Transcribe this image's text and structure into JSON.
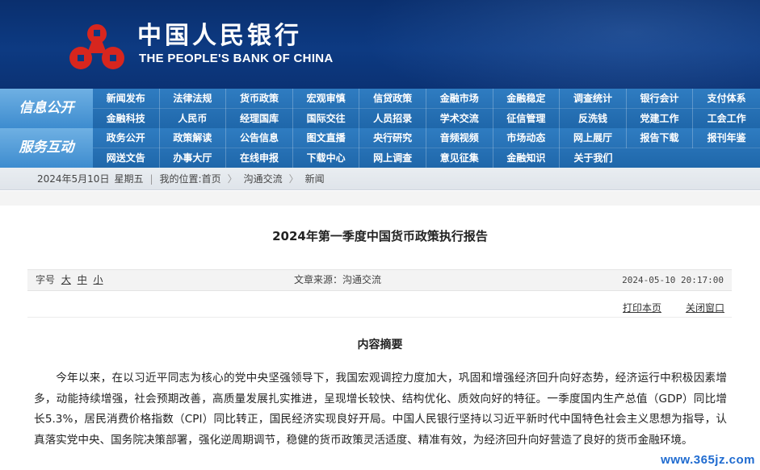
{
  "header": {
    "name_cn": "中国人民银行",
    "name_en": "THE PEOPLE'S BANK OF CHINA",
    "logo_color": "#d7261e"
  },
  "nav": {
    "info_label": "信息公开",
    "service_label": "服务互动",
    "info_row1": [
      "新闻发布",
      "法律法规",
      "货币政策",
      "宏观审慎",
      "信贷政策",
      "金融市场",
      "金融稳定",
      "调查统计",
      "银行会计",
      "支付体系"
    ],
    "info_row2": [
      "金融科技",
      "人民币",
      "经理国库",
      "国际交往",
      "人员招录",
      "学术交流",
      "征信管理",
      "反洗钱",
      "党建工作",
      "工会工作"
    ],
    "service_row1": [
      "政务公开",
      "政策解读",
      "公告信息",
      "图文直播",
      "央行研究",
      "音频视频",
      "市场动态",
      "网上展厅",
      "报告下载",
      "报刊年鉴"
    ],
    "service_row2": [
      "网送文告",
      "办事大厅",
      "在线申报",
      "下载中心",
      "网上调查",
      "意见征集",
      "金融知识",
      "关于我们"
    ]
  },
  "breadcrumb": {
    "date": "2024年5月10日",
    "weekday": "星期五",
    "location_label": "我的位置:",
    "home": "首页",
    "section": "沟通交流",
    "current": "新闻",
    "sep": "〉"
  },
  "article": {
    "title": "2024年第一季度中国货币政策执行报告",
    "font_size_label": "字号",
    "font_sizes": [
      "大",
      "中",
      "小"
    ],
    "source": "文章来源：沟通交流",
    "datetime": "2024-05-10 20:17:00",
    "print_label": "打印本页",
    "close_label": "关闭窗口",
    "section_title": "内容摘要",
    "paragraph": "今年以来，在以习近平同志为核心的党中央坚强领导下，我国宏观调控力度加大，巩固和增强经济回升向好态势，经济运行中积极因素增多，动能持续增强，社会预期改善，高质量发展扎实推进，呈现增长较快、结构优化、质效向好的特征。一季度国内生产总值（GDP）同比增长5.3%，居民消费价格指数（CPI）同比转正，国民经济实现良好开局。中国人民银行坚持以习近平新时代中国特色社会主义思想为指导，认真落实党中央、国务院决策部署，强化逆周期调节，稳健的货币政策灵活适度、精准有效，为经济回升向好营造了良好的货币金融环境。"
  },
  "watermark": "www.365jz.com"
}
